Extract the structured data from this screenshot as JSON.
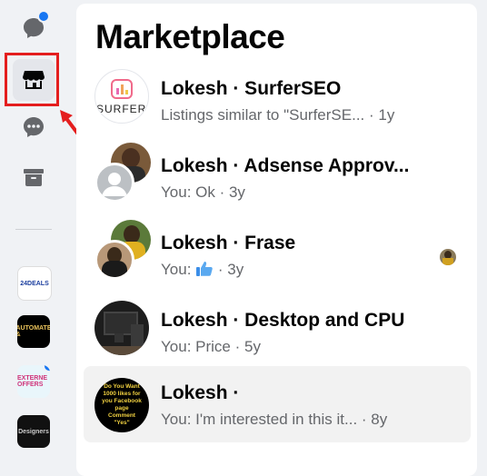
{
  "rail": {
    "items": [
      {
        "icon": "chats-icon"
      },
      {
        "icon": "marketplace-store-icon"
      },
      {
        "icon": "message-requests-icon"
      },
      {
        "icon": "archive-icon"
      }
    ],
    "shortcuts": [
      {
        "label": "24DEALS",
        "color": "#ffffff"
      },
      {
        "label": "AUTOMATE &",
        "color": "#000000"
      },
      {
        "label": "EXTERNE OFFERS",
        "color": "#e9f6fb"
      },
      {
        "label": "Designers",
        "color": "#111111"
      }
    ]
  },
  "panel": {
    "title": "Marketplace",
    "conversations": [
      {
        "name": "Lokesh · SurferSEO",
        "snippet": "Listings similar to \"SurferSE...",
        "time": "· 1y",
        "thumb_text": "SURFER",
        "active": false
      },
      {
        "name": "Lokesh · Adsense Approv...",
        "snippet": "You: Ok",
        "time": "· 3y",
        "active": false
      },
      {
        "name": "Lokesh · Frase",
        "snippet": "You:",
        "time": "· 3y",
        "active": false,
        "reaction": "thumbs-up-icon"
      },
      {
        "name": "Lokesh · Desktop and CPU",
        "snippet": "You: Price",
        "time": "· 5y",
        "active": false
      },
      {
        "name": "Lokesh ·",
        "snippet": "You: I'm interested in this it...",
        "time": "· 8y",
        "thumb_text": "Do You Want 1000 likes for you Facebook page Comment \"Yes\"",
        "active": true
      }
    ]
  },
  "colors": {
    "accent": "#1877f2",
    "highlight": "#e41e1e",
    "arrow": "#e41e1e"
  }
}
